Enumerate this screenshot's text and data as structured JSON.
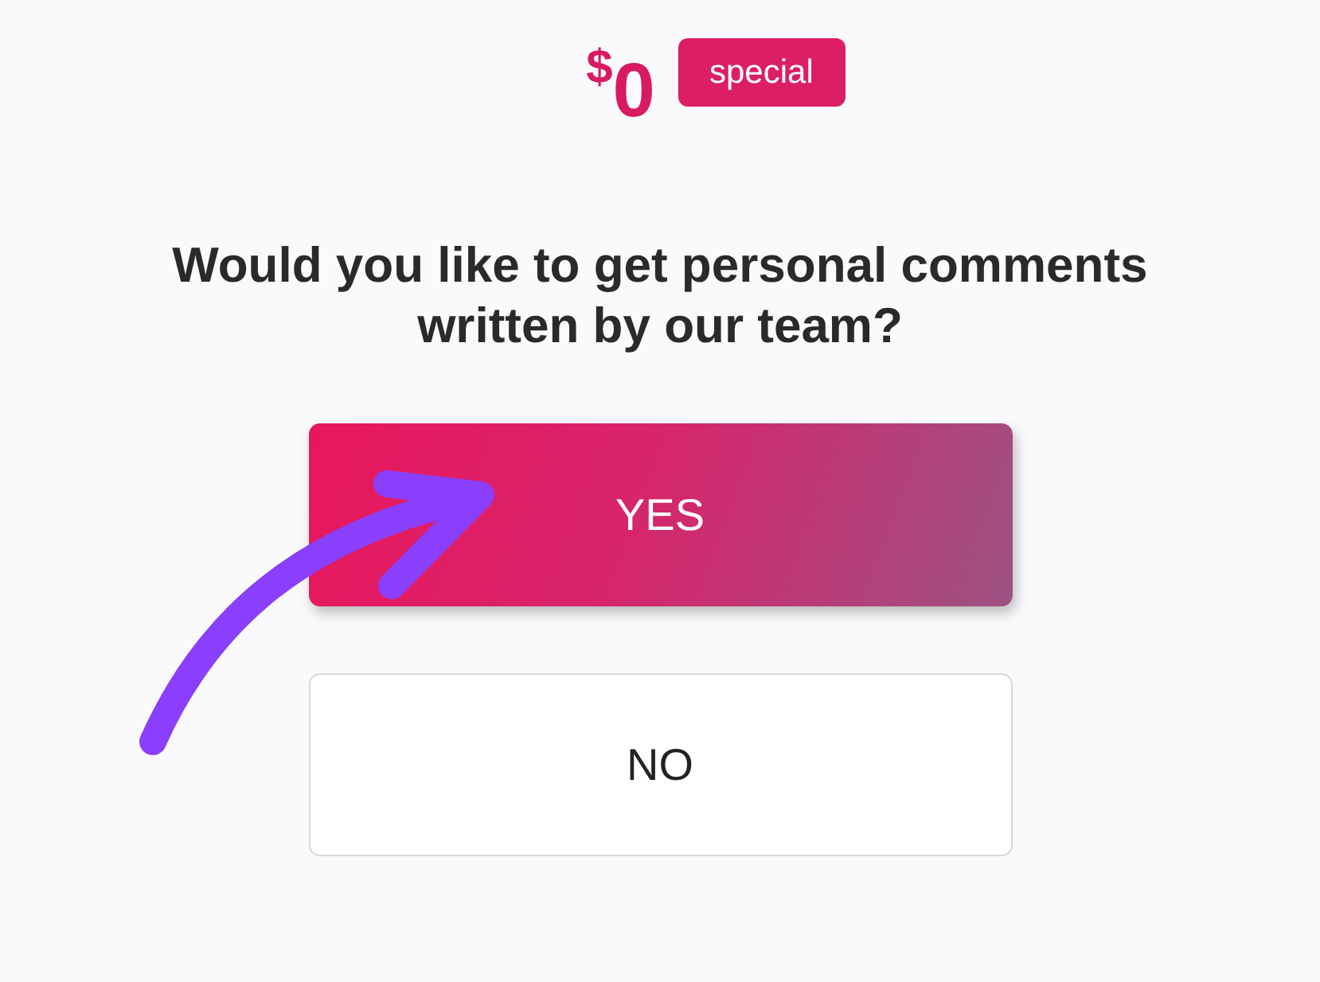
{
  "price": {
    "currency": "$",
    "amount": "0",
    "badge": "special"
  },
  "question": "Would you like to get personal comments written by our team?",
  "options": [
    {
      "label": "YES",
      "selected": true
    },
    {
      "label": "NO",
      "selected": false
    }
  ]
}
